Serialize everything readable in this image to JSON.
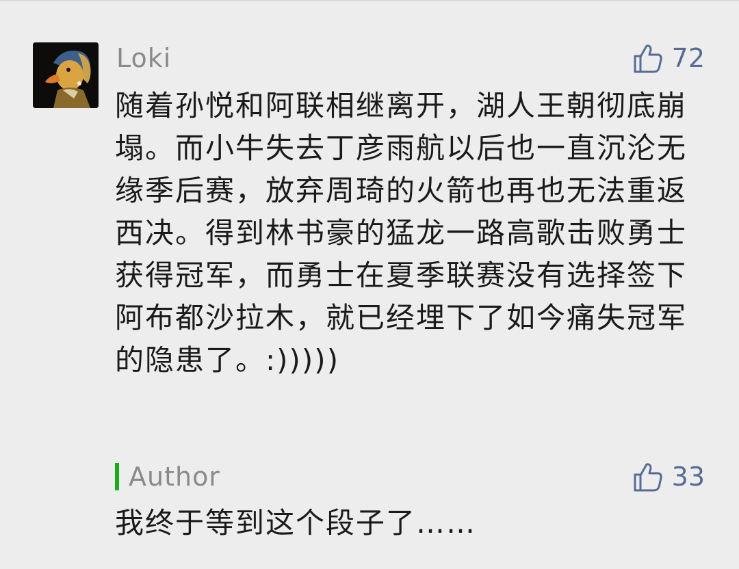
{
  "comment": {
    "username": "Loki",
    "avatar_icon": "girl-with-pearl-earring-duck-avatar",
    "likes": "72",
    "text": "随着孙悦和阿联相继离开，湖人王朝彻底崩塌。而小牛失去丁彦雨航以后也一直沉沦无缘季后赛，放弃周琦的火箭也再也无法重返西决。得到林书豪的猛龙一路高歌击败勇士获得冠军，而勇士在夏季联赛没有选择签下阿布都沙拉木，就已经埋下了如今痛失冠军的隐患了。:)))))"
  },
  "reply": {
    "label": "Author",
    "likes": "33",
    "text": "我终于等到这个段子了……"
  },
  "icons": {
    "like": "thumbs-up-icon"
  },
  "colors": {
    "background": "#ededed",
    "like_accent": "#576b95",
    "author_bar": "#1aad19",
    "name_gray": "#8a8a8a",
    "text": "#1a1a1a"
  }
}
